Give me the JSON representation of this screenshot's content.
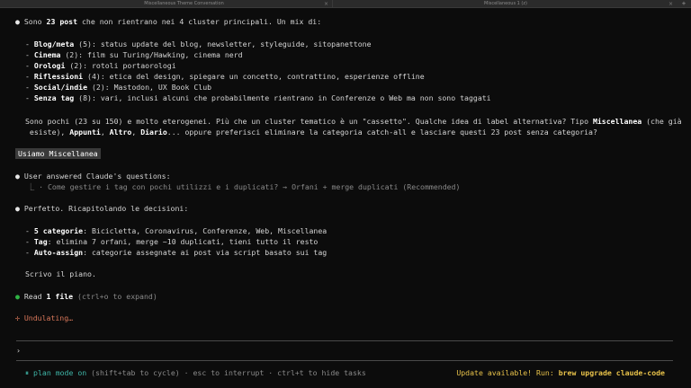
{
  "window": {
    "tabs": [
      {
        "label": "Miscellaneous Theme Conversation"
      },
      {
        "label": "Miscellaneous 1 (z)"
      }
    ],
    "close_glyph": "×",
    "add_glyph": "+"
  },
  "summary": {
    "intro_pre": "Sono ",
    "intro_bold": "23 post",
    "intro_post": " che non rientrano nei 4 cluster principali. Un mix di:",
    "items": [
      {
        "name": "Blog/meta",
        "detail": " (5): status update del blog, newsletter, styleguide, sitopanettone"
      },
      {
        "name": "Cinema",
        "detail": " (2): film su Turing/Hawking, cinema nerd"
      },
      {
        "name": "Orologi",
        "detail": " (2): rotoli portaorologi"
      },
      {
        "name": "Riflessioni",
        "detail": " (4): etica del design, spiegare un concetto, contrattino, esperienze offline"
      },
      {
        "name": "Social/indie",
        "detail": " (2): Mastodon, UX Book Club"
      },
      {
        "name": "Senza tag",
        "detail": " (8): vari, inclusi alcuni che probabilmente rientrano in Conferenze o Web ma non sono taggati"
      }
    ],
    "para_line1_pre": "Sono pochi (23 su 150) e molto eterogenei. Più che un cluster tematico è un \"cassetto\". Qualche idea di label alternativa? Tipo ",
    "para_line1_bold": "Miscellanea",
    "para_line1_post": " (che già",
    "para_line2_pre": " esiste), ",
    "para_line2_b1": "Appunti",
    "para_line2_sep1": ", ",
    "para_line2_b2": "Altro",
    "para_line2_sep2": ", ",
    "para_line2_b3": "Diario",
    "para_line2_post": "... oppure preferisci eliminare la categoria catch-all e lasciare questi 23 post senza categoria?"
  },
  "user_message": "Usiamo Miscellanea",
  "answered": {
    "title": "User answered Claude's questions:",
    "branch_glyph": "⎿",
    "detail": " · Come gestire i tag con pochi utilizzi e i duplicati? → Orfani + merge duplicati (Recommended)"
  },
  "decisions": {
    "intro": "Perfetto. Ricapitolando le decisioni:",
    "items": [
      {
        "name": "5 categorie",
        "detail": ": Bicicletta, Coronavirus, Conferenze, Web, Miscellanea"
      },
      {
        "name": "Tag",
        "detail": ": elimina 7 orfani, merge ~10 duplicati, tieni tutto il resto"
      },
      {
        "name": "Auto-assign",
        "detail": ": categorie assegnate ai post via script basato sui tag"
      }
    ],
    "outro": "Scrivo il piano."
  },
  "read_file": {
    "pre": "Read ",
    "bold": "1 file",
    "hint": " (ctrl+o to expand)"
  },
  "spinner": {
    "glyph": "✢",
    "text": "Undulating…"
  },
  "prompt_glyph": "›",
  "bullet_glyph": "●",
  "dash_glyph": "-",
  "status": {
    "mode_glyph": "⏸",
    "mode_label": "plan mode on",
    "mode_hint": " (shift+tab to cycle) · esc to interrupt · ctrl+t to hide tasks",
    "update_pre": "Update available! Run: ",
    "update_cmd": "brew upgrade claude-code"
  },
  "colors": {
    "background": "#0c0c0c",
    "text": "#d4d4d4",
    "bullet_green": "#2fb344",
    "spinner_orange": "#d9775a",
    "plan_mode_teal": "#3fb6a8",
    "update_yellow": "#e8c24a",
    "user_msg_bg": "#3a3a3a"
  }
}
